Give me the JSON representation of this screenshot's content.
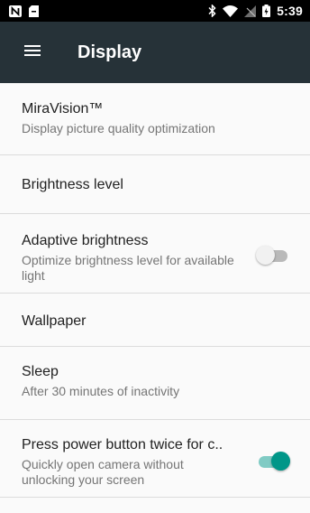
{
  "status_bar": {
    "time": "5:39",
    "icons": [
      "nfc-icon",
      "sd-card-icon",
      "bluetooth-icon",
      "wifi-icon",
      "no-signal-icon",
      "battery-icon"
    ]
  },
  "app_bar": {
    "title": "Display",
    "menu_icon": "hamburger-menu-icon",
    "background": "#263238"
  },
  "preferences": [
    {
      "title": "MiraVision™",
      "summary": "Display picture quality optimization"
    },
    {
      "title": "Brightness level"
    },
    {
      "title": "Adaptive brightness",
      "summary": "Optimize brightness level for available light",
      "toggle_on": false
    },
    {
      "title": "Wallpaper"
    },
    {
      "title": "Sleep",
      "summary": "After 30 minutes of inactivity"
    },
    {
      "title": "Press power button twice for c..",
      "summary": "Quickly open camera without unlocking your screen",
      "toggle_on": true
    }
  ],
  "colors": {
    "accent": "#009688",
    "accent_track": "#80cbc4",
    "list_background": "#fafafa",
    "divider": "#dcdcdc"
  }
}
